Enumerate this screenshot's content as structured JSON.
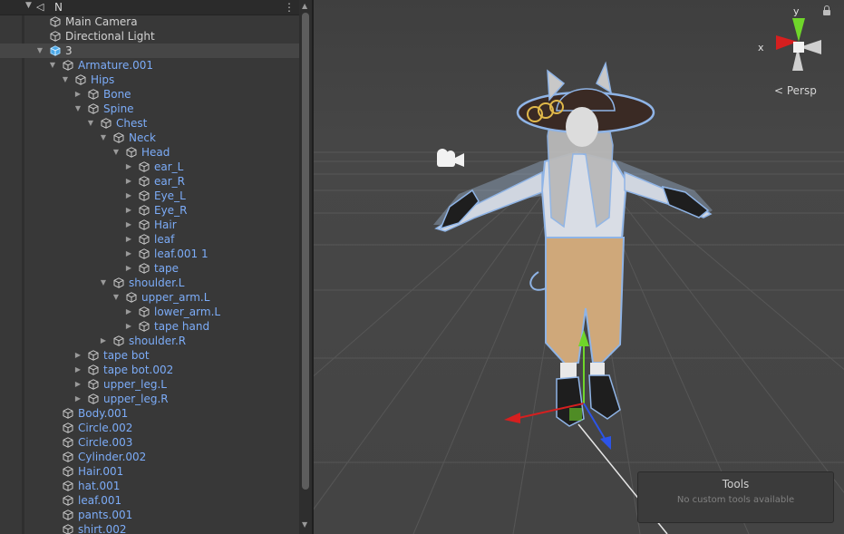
{
  "hierarchy": {
    "root_label": "N",
    "menu_dots": "⋮",
    "rows": [
      {
        "label": "Main Camera",
        "depth": 1,
        "arrow": "",
        "blue": false,
        "selected": false
      },
      {
        "label": "Directional Light",
        "depth": 1,
        "arrow": "",
        "blue": false,
        "selected": false
      },
      {
        "label": "3",
        "depth": 1,
        "arrow": "down",
        "blue": false,
        "selected": true,
        "prefab": true
      },
      {
        "label": "Armature.001",
        "depth": 2,
        "arrow": "down",
        "blue": true
      },
      {
        "label": "Hips",
        "depth": 3,
        "arrow": "down",
        "blue": true
      },
      {
        "label": "Bone",
        "depth": 4,
        "arrow": "right",
        "blue": true
      },
      {
        "label": "Spine",
        "depth": 4,
        "arrow": "down",
        "blue": true
      },
      {
        "label": "Chest",
        "depth": 5,
        "arrow": "down",
        "blue": true
      },
      {
        "label": "Neck",
        "depth": 6,
        "arrow": "down",
        "blue": true
      },
      {
        "label": "Head",
        "depth": 7,
        "arrow": "down",
        "blue": true
      },
      {
        "label": "ear_L",
        "depth": 8,
        "arrow": "right",
        "blue": true
      },
      {
        "label": "ear_R",
        "depth": 8,
        "arrow": "right",
        "blue": true
      },
      {
        "label": "Eye_L",
        "depth": 8,
        "arrow": "right",
        "blue": true
      },
      {
        "label": "Eye_R",
        "depth": 8,
        "arrow": "right",
        "blue": true
      },
      {
        "label": "Hair",
        "depth": 8,
        "arrow": "right",
        "blue": true
      },
      {
        "label": "leaf",
        "depth": 8,
        "arrow": "right",
        "blue": true
      },
      {
        "label": "leaf.001 1",
        "depth": 8,
        "arrow": "right",
        "blue": true
      },
      {
        "label": "tape",
        "depth": 8,
        "arrow": "right",
        "blue": true
      },
      {
        "label": "shoulder.L",
        "depth": 6,
        "arrow": "down",
        "blue": true
      },
      {
        "label": "upper_arm.L",
        "depth": 7,
        "arrow": "down",
        "blue": true
      },
      {
        "label": "lower_arm.L",
        "depth": 8,
        "arrow": "right",
        "blue": true
      },
      {
        "label": "tape hand",
        "depth": 8,
        "arrow": "right",
        "blue": true
      },
      {
        "label": "shoulder.R",
        "depth": 6,
        "arrow": "right",
        "blue": true
      },
      {
        "label": "tape bot",
        "depth": 4,
        "arrow": "right",
        "blue": true
      },
      {
        "label": "tape bot.002",
        "depth": 4,
        "arrow": "right",
        "blue": true
      },
      {
        "label": "upper_leg.L",
        "depth": 4,
        "arrow": "right",
        "blue": true
      },
      {
        "label": "upper_leg.R",
        "depth": 4,
        "arrow": "right",
        "blue": true
      },
      {
        "label": "Body.001",
        "depth": 2,
        "arrow": "",
        "blue": true
      },
      {
        "label": "Circle.002",
        "depth": 2,
        "arrow": "",
        "blue": true
      },
      {
        "label": "Circle.003",
        "depth": 2,
        "arrow": "",
        "blue": true
      },
      {
        "label": "Cylinder.002",
        "depth": 2,
        "arrow": "",
        "blue": true
      },
      {
        "label": "Hair.001",
        "depth": 2,
        "arrow": "",
        "blue": true
      },
      {
        "label": "hat.001",
        "depth": 2,
        "arrow": "",
        "blue": true
      },
      {
        "label": "leaf.001",
        "depth": 2,
        "arrow": "",
        "blue": true
      },
      {
        "label": "pants.001",
        "depth": 2,
        "arrow": "",
        "blue": true
      },
      {
        "label": "shirt.002",
        "depth": 2,
        "arrow": "",
        "blue": true
      }
    ]
  },
  "scene": {
    "projection_label": "< Persp",
    "gizmo_x_label": "x",
    "gizmo_y_label": "y"
  },
  "tools_overlay": {
    "title": "Tools",
    "subtitle": "No custom tools available"
  },
  "colors": {
    "hierarchy_bg": "#383838",
    "scene_bg": "#454545",
    "blue_text": "#7cacf8",
    "axis_x": "#d61f1f",
    "axis_y": "#6fd62a",
    "axis_z": "#2c54e8"
  }
}
